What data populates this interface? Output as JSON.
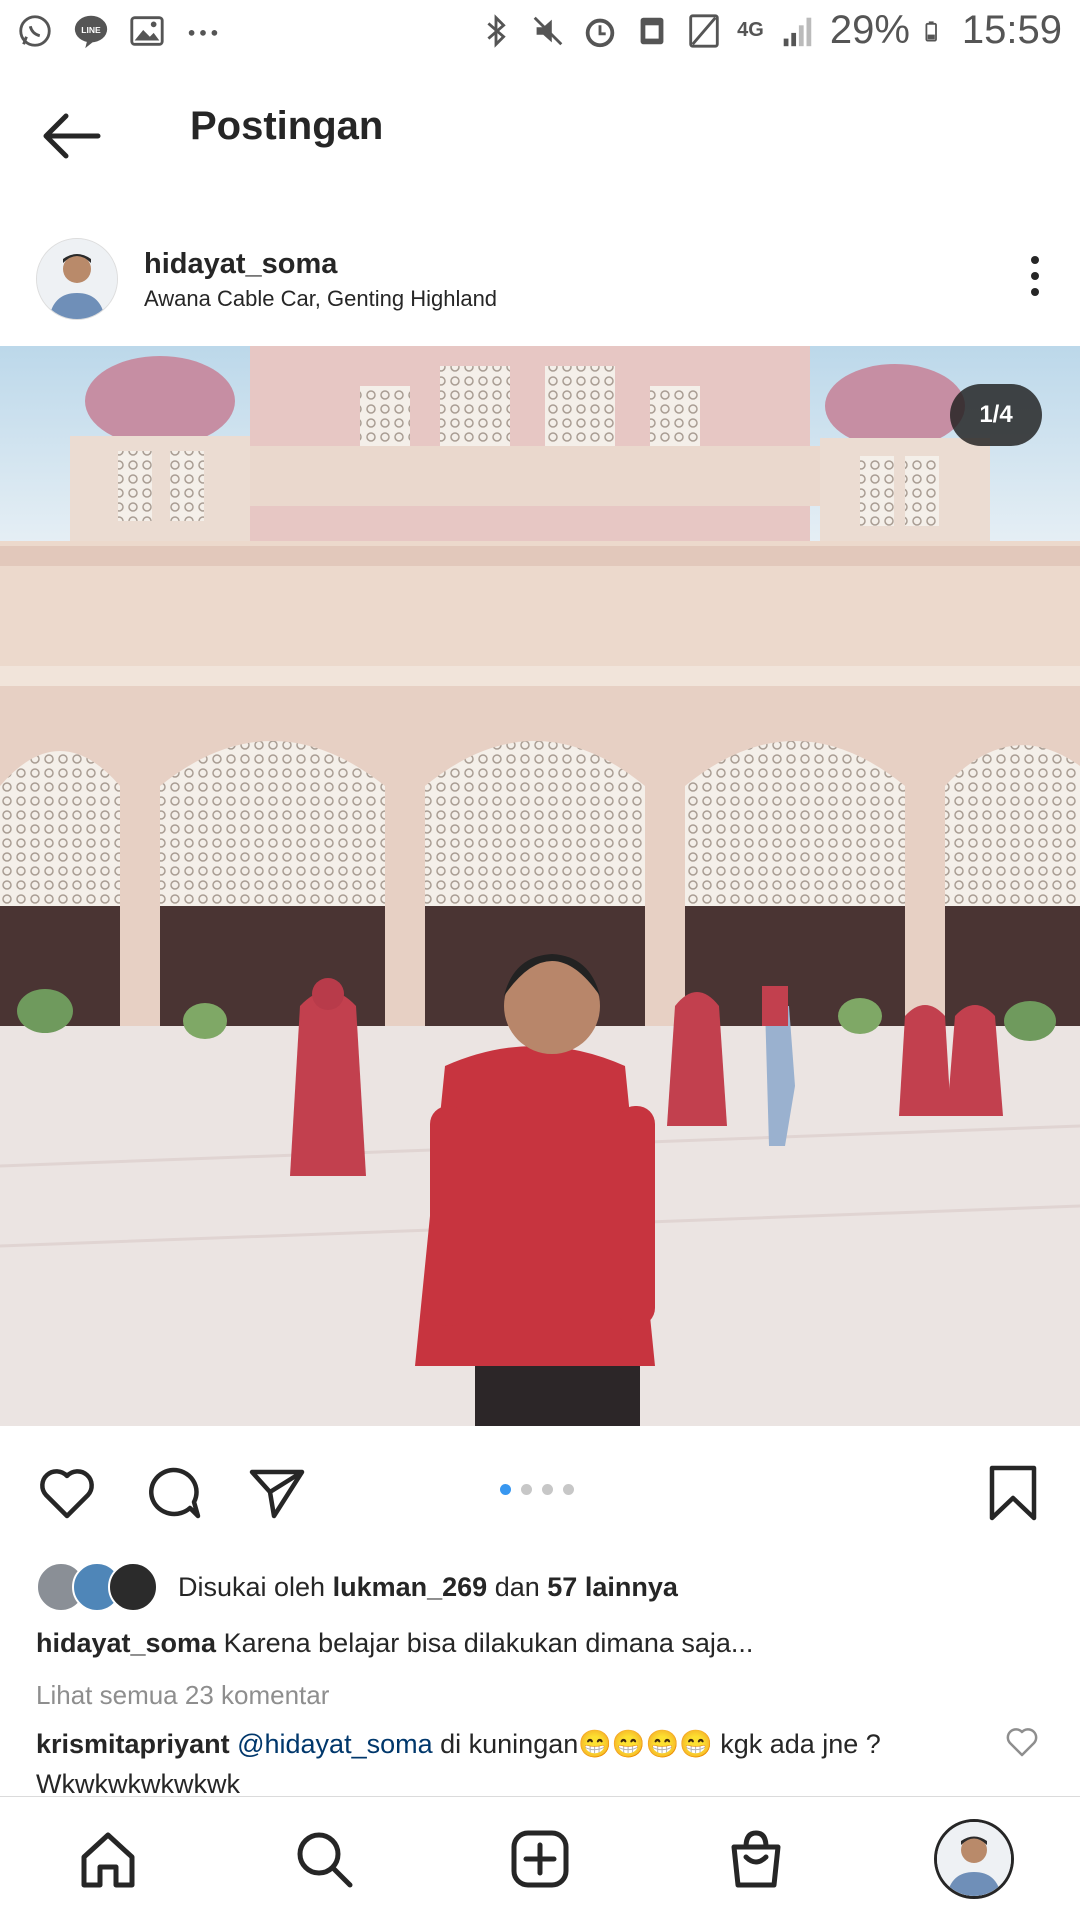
{
  "status_bar": {
    "battery": "29%",
    "time": "15:59",
    "network": "4G",
    "left_icons": [
      "whatsapp-icon",
      "line-icon",
      "gallery-icon",
      "more-dots-icon"
    ],
    "right_icons": [
      "bluetooth-icon",
      "mute-icon",
      "alarm-icon",
      "nfc-icon",
      "no-sim-icon",
      "signal-icon",
      "battery-icon"
    ]
  },
  "appbar": {
    "title": "Postingan"
  },
  "post": {
    "username": "hidayat_soma",
    "location": "Awana Cable Car, Genting Highland",
    "image_counter": "1/4",
    "carousel": {
      "count": 4,
      "active": 0
    },
    "likes": {
      "prefix": "Disukai oleh",
      "user": "lukman_269",
      "middle": "dan",
      "others": "57 lainnya"
    },
    "caption": {
      "user": "hidayat_soma",
      "text": "Karena belajar bisa dilakukan dimana saja..."
    },
    "view_comments": "Lihat semua 23 komentar",
    "comment": {
      "user": "krismitapriyant",
      "mention": "@hidayat_soma",
      "text": "di kuningan😁😁😁😁 kgk ada jne ? Wkwkwkwkwkwk"
    }
  },
  "colors": {
    "accent": "#3897f0",
    "text": "#262626",
    "muted": "#8e8e8e",
    "mention": "#00376b"
  }
}
